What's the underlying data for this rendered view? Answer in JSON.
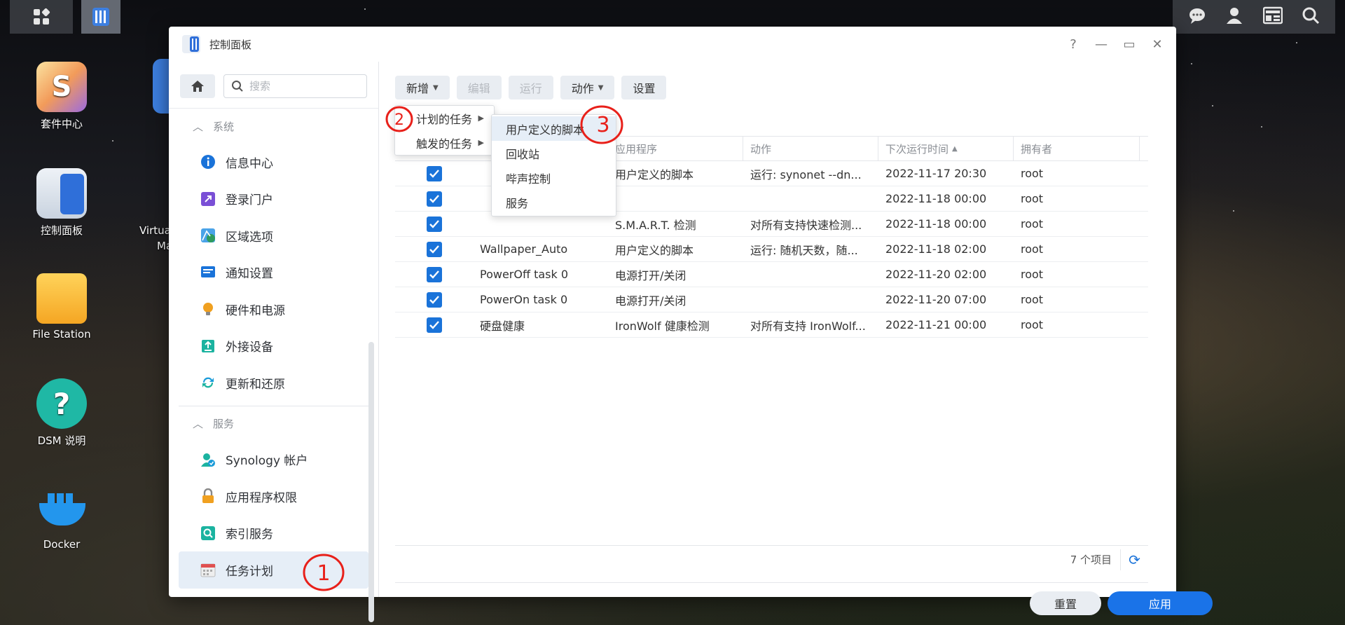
{
  "desktop": {
    "icons": [
      {
        "label": "套件中心"
      },
      {
        "label": "控制面板"
      },
      {
        "label": "File Station"
      },
      {
        "label": "DSM 说明"
      },
      {
        "label": "Docker"
      }
    ],
    "partial_label_1": "Virtua",
    "partial_label_2": "Ma"
  },
  "window": {
    "title": "控制面板",
    "controls": {
      "help": "?",
      "minimize": "—",
      "maximize": "▭",
      "close": "✕"
    }
  },
  "sidebar": {
    "search_placeholder": "搜索",
    "section_system": "系统",
    "system_items": [
      {
        "label": "信息中心",
        "icon": "info-icon",
        "color": "#1a73d9"
      },
      {
        "label": "登录门户",
        "icon": "login-portal-icon",
        "color": "#7a4fd6"
      },
      {
        "label": "区域选项",
        "icon": "region-icon",
        "color": "#2e9b5e"
      },
      {
        "label": "通知设置",
        "icon": "notification-icon",
        "color": "#1a73d9"
      },
      {
        "label": "硬件和电源",
        "icon": "bulb-icon",
        "color": "#f0a020"
      },
      {
        "label": "外接设备",
        "icon": "external-device-icon",
        "color": "#1bb3a0"
      },
      {
        "label": "更新和还原",
        "icon": "update-icon",
        "color": "#1a9bd9"
      }
    ],
    "section_services": "服务",
    "service_items": [
      {
        "label": "Synology 帐户",
        "icon": "account-icon",
        "color": "#1a9bd9"
      },
      {
        "label": "应用程序权限",
        "icon": "lock-icon",
        "color": "#f0a020"
      },
      {
        "label": "索引服务",
        "icon": "index-icon",
        "color": "#1bb3a0"
      },
      {
        "label": "任务计划",
        "icon": "calendar-icon",
        "color": "#e05050"
      }
    ]
  },
  "toolbar": {
    "add": "新增",
    "edit": "编辑",
    "run": "运行",
    "action": "动作",
    "settings": "设置"
  },
  "table": {
    "columns": [
      "",
      "",
      "应用程序",
      "动作",
      "下次运行时间",
      "拥有者"
    ],
    "rows": [
      {
        "checked": true,
        "name": "",
        "app": "用户定义的脚本",
        "action": "运行: synonet --dn...",
        "next_run": "2022-11-17 20:30",
        "owner": "root"
      },
      {
        "checked": true,
        "name": "",
        "app": "",
        "action": "",
        "next_run": "2022-11-18 00:00",
        "owner": "root"
      },
      {
        "checked": true,
        "name": "",
        "app": "S.M.A.R.T. 检测",
        "action": "对所有支持快速检测...",
        "next_run": "2022-11-18 00:00",
        "owner": "root"
      },
      {
        "checked": true,
        "name": "Wallpaper_Auto",
        "app": "用户定义的脚本",
        "action": "运行: 随机天数，随...",
        "next_run": "2022-11-18 02:00",
        "owner": "root"
      },
      {
        "checked": true,
        "name": "PowerOff task 0",
        "app": "电源打开/关闭",
        "action": "",
        "next_run": "2022-11-20 02:00",
        "owner": "root"
      },
      {
        "checked": true,
        "name": "PowerOn task 0",
        "app": "电源打开/关闭",
        "action": "",
        "next_run": "2022-11-20 07:00",
        "owner": "root"
      },
      {
        "checked": true,
        "name": "硬盘健康",
        "app": "IronWolf 健康检测",
        "action": "对所有支持 IronWolf...",
        "next_run": "2022-11-21 00:00",
        "owner": "root"
      }
    ],
    "count": "7 个项目"
  },
  "add_menu": {
    "items": [
      "计划的任务",
      "触发的任务"
    ]
  },
  "submenu": {
    "items": [
      "用户定义的脚本",
      "回收站",
      "哔声控制",
      "服务"
    ]
  },
  "footer": {
    "reset": "重置",
    "apply": "应用"
  },
  "annotations": [
    "1",
    "2",
    "3"
  ],
  "colors": {
    "accent": "#1a73e8",
    "annotation": "#e8201a"
  }
}
